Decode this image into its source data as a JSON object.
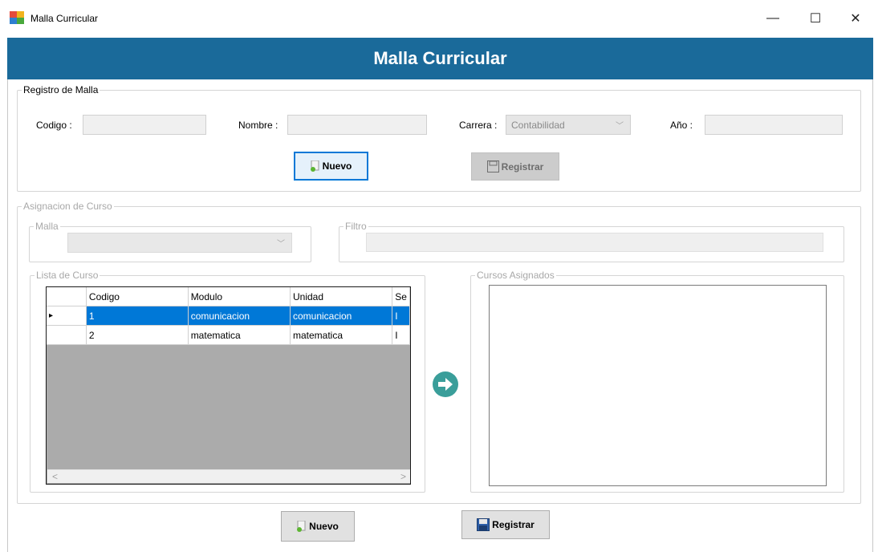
{
  "window": {
    "title": "Malla Curricular",
    "minimize_glyph": "—",
    "maximize_glyph": "☐",
    "close_glyph": "✕"
  },
  "banner": {
    "title": "Malla Curricular",
    "color": "#1a6a9a"
  },
  "registro": {
    "legend": "Registro de Malla",
    "codigo_label": "Codigo :",
    "codigo_value": "",
    "nombre_label": "Nombre :",
    "nombre_value": "",
    "carrera_label": "Carrera :",
    "carrera_value": "Contabilidad",
    "anio_label": "Año :",
    "anio_value": "",
    "nuevo_label": "Nuevo",
    "registrar_label": "Registrar"
  },
  "asignacion": {
    "legend": "Asignacion de Curso",
    "malla_legend": "Malla",
    "malla_value": "",
    "filtro_legend": "Filtro",
    "filtro_value": "",
    "lista_legend": "Lista de Curso",
    "asignados_legend": "Cursos Asignados",
    "columns": [
      "Codigo",
      "Modulo",
      "Unidad",
      "Se"
    ],
    "rows": [
      {
        "cells": [
          "1",
          "comunicacion",
          "comunicacion",
          "I"
        ],
        "selected": true,
        "indicator": "▸"
      },
      {
        "cells": [
          "2",
          "matematica",
          "matematica",
          "I"
        ],
        "selected": false,
        "indicator": ""
      }
    ],
    "scroll_left": "<",
    "scroll_right": ">"
  },
  "footer": {
    "nuevo_label": "Nuevo",
    "registrar_label": "Registrar"
  },
  "icons": {
    "arrow_button_color": "#3a9e9a",
    "accent_selection": "#0078d7"
  }
}
